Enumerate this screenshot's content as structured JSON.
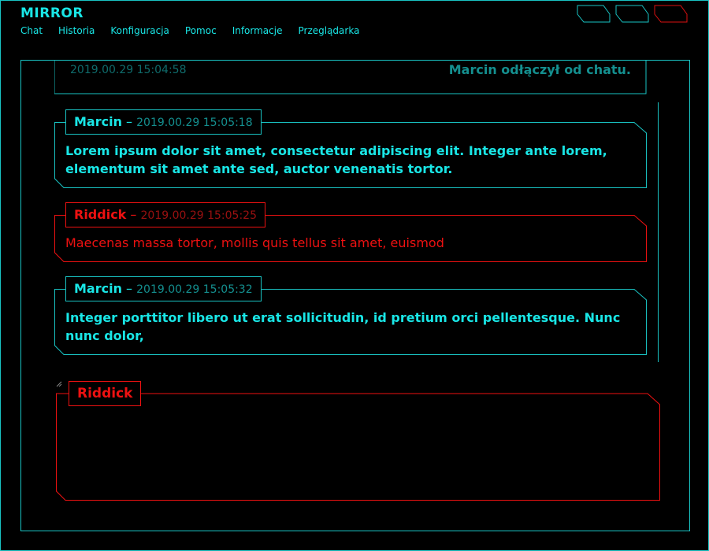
{
  "app": {
    "title": "MIRROR"
  },
  "menu": {
    "items": [
      {
        "label": "Chat"
      },
      {
        "label": "Historia"
      },
      {
        "label": "Konfiguracja"
      },
      {
        "label": "Pomoc"
      },
      {
        "label": "Informacje"
      },
      {
        "label": "Przeglądarka"
      }
    ]
  },
  "window_buttons": {
    "colors": {
      "cyan": "#19c3c3",
      "red": "#dd1111"
    }
  },
  "chat": {
    "partial_previous": {
      "timestamp": "2019.00.29 15:04:58",
      "text": "Marcin odłączył od chatu."
    },
    "messages": [
      {
        "author": "Marcin",
        "separator": " – ",
        "timestamp": "2019.00.29 15:05:18",
        "text": "Lorem ipsum dolor sit amet, consectetur adipiscing elit. Integer ante lorem, elementum sit amet ante sed, auctor venenatis tortor.",
        "color": "cyan"
      },
      {
        "author": "Riddick",
        "separator": " – ",
        "timestamp": "2019.00.29 15:05:25",
        "text": "Maecenas massa tortor, mollis quis tellus sit amet, euismod",
        "color": "red"
      },
      {
        "author": "Marcin",
        "separator": " – ",
        "timestamp": "2019.00.29 15:05:32",
        "text": "Integer porttitor libero ut erat sollicitudin, id pretium orci pellentesque. Nunc nunc dolor,",
        "color": "cyan"
      }
    ]
  },
  "compose": {
    "author": "Riddick",
    "value": "",
    "placeholder": ""
  },
  "colors": {
    "accent": "#19e6e6",
    "border": "#19c3c3",
    "own": "#ee1111",
    "background": "#000000"
  }
}
